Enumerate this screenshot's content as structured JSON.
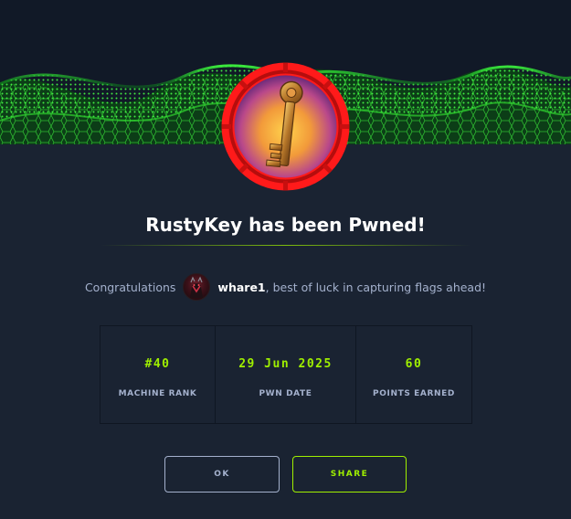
{
  "dialog": {
    "title": "RustyKey has been Pwned!",
    "congrats_prefix": "Congratulations",
    "username": "whare1",
    "congrats_suffix": ", best of luck in capturing flags ahead!"
  },
  "stats": [
    {
      "value": "#40",
      "label": "MACHINE RANK"
    },
    {
      "value": "29 Jun 2025",
      "label": "PWN DATE"
    },
    {
      "value": "60",
      "label": "POINTS EARNED"
    }
  ],
  "buttons": {
    "ok_label": "OK",
    "share_label": "SHARE"
  },
  "colors": {
    "background": "#1a2332",
    "accent": "#9fef00",
    "badge_ring": "#ff1a1a",
    "muted_text": "#a4b1cd"
  },
  "icons": {
    "badge": "golden-key-icon",
    "banner": "green-hex-wave-banner"
  }
}
